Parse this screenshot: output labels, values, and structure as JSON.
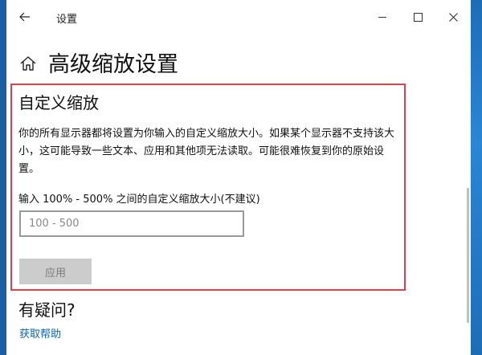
{
  "window": {
    "title": "设置"
  },
  "page": {
    "title": "高级缩放设置"
  },
  "custom_scaling": {
    "heading": "自定义缩放",
    "description": "你的所有显示器都将设置为你输入的自定义缩放大小。如果某个显示器不支持该大小，这可能导致一些文本、应用和其他项无法读取。可能很难恢复到你的原始设置。",
    "input_label": "输入 100% - 500% 之间的自定义缩放大小(不建议)",
    "input_placeholder": "100 - 500",
    "input_value": "",
    "apply_label": "应用"
  },
  "help": {
    "heading": "有疑问?",
    "link_label": "获取帮助"
  },
  "colors": {
    "highlight_border": "#d9424d",
    "link": "#0a64b5",
    "disabled_button": "#cccccc"
  },
  "icons": {
    "back": "back-arrow-icon",
    "minimize": "minimize-icon",
    "maximize": "maximize-icon",
    "close": "close-icon",
    "home": "home-icon"
  }
}
